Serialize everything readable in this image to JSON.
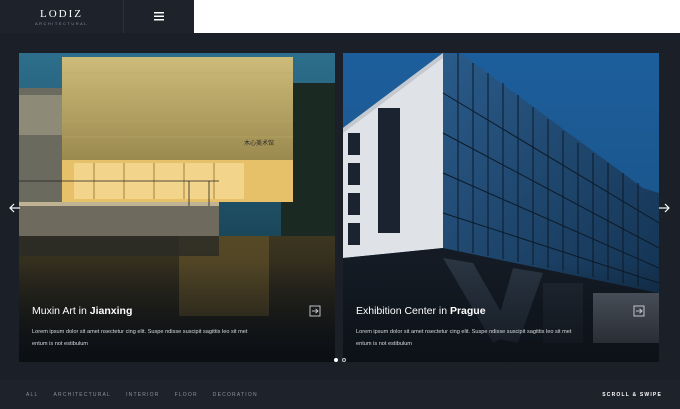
{
  "header": {
    "logo_text": "LODIZ",
    "logo_subtext": "ARCHITECTURAL",
    "menu_icon": "hamburger-icon"
  },
  "slider": {
    "slides": [
      {
        "title_prefix": "Muxin Art in ",
        "title_highlight": "Jianxing",
        "description": "Lorem ipsum dolor sit amet nsectetur cing elit. Suspe ndisse suscipit sagittis leo sit met entum is not estibulum",
        "icon": "exit-icon",
        "sign_text": "木心美术馆"
      },
      {
        "title_prefix": "Exhibition Center in ",
        "title_highlight": "Prague",
        "description": "Lorem ipsum dolor sit amet nsectetur cing elit. Suspe ndisse suscipit sagittis leo sit met entum is not estibulum",
        "icon": "exit-icon"
      }
    ],
    "active_page": 1,
    "page_count": 2
  },
  "footer": {
    "filters": [
      "ALL",
      "ARCHITECTURAL",
      "INTERIOR",
      "FLOOR",
      "DECORATION"
    ],
    "scroll_label": "SCROLL & SWIPE"
  },
  "colors": {
    "background": "#1b1f27",
    "header": "#1d222b",
    "accent": "#ffffff"
  }
}
